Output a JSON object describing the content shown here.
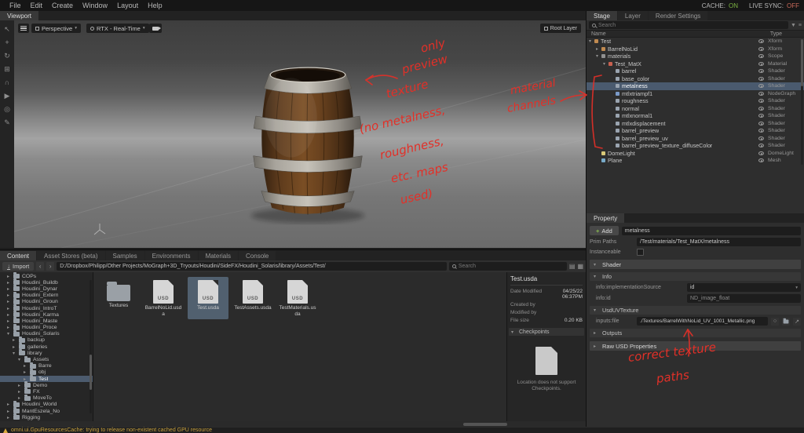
{
  "menu": {
    "items": [
      "File",
      "Edit",
      "Create",
      "Window",
      "Layout",
      "Help"
    ],
    "cache_label": "CACHE:",
    "cache_value": "ON",
    "live_sync_label": "LIVE SYNC:",
    "live_sync_value": "OFF"
  },
  "viewport": {
    "tab": "Viewport",
    "camera": "Perspective",
    "renderer": "RTX - Real-Time",
    "root_layer": "Root Layer",
    "tools": [
      {
        "name": "select-tool",
        "glyph": "↖"
      },
      {
        "name": "move-tool",
        "glyph": "+"
      },
      {
        "name": "rotate-tool",
        "glyph": "↻"
      },
      {
        "name": "scale-tool",
        "glyph": "⊞"
      },
      {
        "name": "snap-tool",
        "glyph": "∩"
      },
      {
        "name": "play-tool",
        "glyph": "▶"
      },
      {
        "name": "focus-tool",
        "glyph": "◎"
      },
      {
        "name": "paint-tool",
        "glyph": "✎"
      }
    ]
  },
  "stage": {
    "tabs": [
      "Stage",
      "Layer",
      "Render Settings"
    ],
    "search_placeholder": "Search",
    "name_col": "Name",
    "type_col": "Type",
    "rows": [
      {
        "name": "Test",
        "type": "Xform",
        "depth": 0,
        "exp": "open"
      },
      {
        "name": "BarrelNoLid",
        "type": "Xform",
        "depth": 1,
        "exp": "closed"
      },
      {
        "name": "materials",
        "type": "Scope",
        "depth": 1,
        "exp": "open"
      },
      {
        "name": "Test_MatX",
        "type": "Material",
        "depth": 2,
        "exp": "open"
      },
      {
        "name": "barrel",
        "type": "Shader",
        "depth": 3,
        "exp": "none"
      },
      {
        "name": "base_color",
        "type": "Shader",
        "depth": 3,
        "exp": "none"
      },
      {
        "name": "metalness",
        "type": "Shader",
        "depth": 3,
        "exp": "none",
        "selected": true
      },
      {
        "name": "mtlxtriampf1",
        "type": "NodeGraph",
        "depth": 3,
        "exp": "none"
      },
      {
        "name": "roughness",
        "type": "Shader",
        "depth": 3,
        "exp": "none"
      },
      {
        "name": "normal",
        "type": "Shader",
        "depth": 3,
        "exp": "none"
      },
      {
        "name": "mtlxnormal1",
        "type": "Shader",
        "depth": 3,
        "exp": "none"
      },
      {
        "name": "mtlxdisplacement",
        "type": "Shader",
        "depth": 3,
        "exp": "none"
      },
      {
        "name": "barrel_preview",
        "type": "Shader",
        "depth": 3,
        "exp": "none"
      },
      {
        "name": "barrel_preview_uv",
        "type": "Shader",
        "depth": 3,
        "exp": "none"
      },
      {
        "name": "barrel_preview_texture_diffuseColor",
        "type": "Shader",
        "depth": 3,
        "exp": "none"
      },
      {
        "name": "DomeLight",
        "type": "DomeLight",
        "depth": 1,
        "exp": "none"
      },
      {
        "name": "Plane",
        "type": "Mesh",
        "depth": 1,
        "exp": "none"
      }
    ]
  },
  "property": {
    "tab": "Property",
    "add_label": "Add",
    "name_value": "metalness",
    "prim_paths_label": "Prim Paths",
    "prim_paths_value": "/Test/materials/Test_MatX/metalness",
    "instanceable_label": "Instanceable",
    "shader_section": "Shader",
    "info_section": "Info",
    "impl_label": "info:implementationSource",
    "impl_value": "id",
    "id_label": "info:id",
    "id_value": "ND_image_float",
    "texture_section": "UsdUVTexture",
    "file_label": "inputs:file",
    "file_value": "./Textures/BarrelWithNoLid_UV_1001_Metallic.png",
    "outputs_section": "Outputs",
    "raw_section": "Raw USD Properties"
  },
  "content": {
    "tabs": [
      "Content",
      "Asset Stores (beta)",
      "Samples",
      "Environments",
      "Materials",
      "Console"
    ],
    "import_label": "Import",
    "path": "D:/Dropbox/Philipp/Other Projects/MoGraph+3D_Tryouts/Houdini/SideFX/Houdini_Solaris/library/Assets/Test/",
    "search_placeholder": "Search",
    "tree": [
      {
        "label": "COPs",
        "depth": 1,
        "exp": "closed"
      },
      {
        "label": "Houdini_Buildb",
        "depth": 1,
        "exp": "closed"
      },
      {
        "label": "Houdini_Dynar",
        "depth": 1,
        "exp": "closed"
      },
      {
        "label": "Houdini_Extern",
        "depth": 1,
        "exp": "closed"
      },
      {
        "label": "Houdini_Groun",
        "depth": 1,
        "exp": "closed"
      },
      {
        "label": "Houdini_IntroT",
        "depth": 1,
        "exp": "closed"
      },
      {
        "label": "Houdini_Karma",
        "depth": 1,
        "exp": "closed"
      },
      {
        "label": "Houdini_Maste",
        "depth": 1,
        "exp": "closed"
      },
      {
        "label": "Houdini_Proce",
        "depth": 1,
        "exp": "closed"
      },
      {
        "label": "Houdini_Solaris",
        "depth": 1,
        "exp": "open"
      },
      {
        "label": "backup",
        "depth": 2,
        "exp": "closed"
      },
      {
        "label": "galleries",
        "depth": 2,
        "exp": "closed"
      },
      {
        "label": "library",
        "depth": 2,
        "exp": "open"
      },
      {
        "label": "Assets",
        "depth": 3,
        "exp": "open"
      },
      {
        "label": "Barre",
        "depth": 4,
        "exp": "closed"
      },
      {
        "label": "obj",
        "depth": 4,
        "exp": "closed"
      },
      {
        "label": "Test",
        "depth": 4,
        "exp": "closed",
        "selected": true
      },
      {
        "label": "Demo",
        "depth": 3,
        "exp": "closed"
      },
      {
        "label": "FX",
        "depth": 3,
        "exp": "closed"
      },
      {
        "label": "MoveTo",
        "depth": 3,
        "exp": "closed"
      },
      {
        "label": "Houdini_World",
        "depth": 1,
        "exp": "closed"
      },
      {
        "label": "MantEszela_No",
        "depth": 1,
        "exp": "closed"
      },
      {
        "label": "Rigging",
        "depth": 1,
        "exp": "closed"
      }
    ],
    "files": [
      {
        "name": "Textures",
        "kind": "folder"
      },
      {
        "name": "BarrelNoLid.usda",
        "kind": "usd"
      },
      {
        "name": "Test.usda",
        "kind": "usd",
        "selected": true
      },
      {
        "name": "TestAssets.usda",
        "kind": "usd"
      },
      {
        "name": "TestMaterials.usda",
        "kind": "usd"
      }
    ],
    "details": {
      "title": "Test.usda",
      "date_label": "Date Modified",
      "date_value": "04/25/22 06:37PM",
      "created_label": "Created by",
      "created_value": "",
      "modified_label": "Modified by",
      "modified_value": "",
      "size_label": "File size",
      "size_value": "0.20 KB",
      "checkpoints_label": "Checkpoints",
      "checkpoints_message": "Location does not support Checkpoints."
    }
  },
  "status": {
    "warning": "omni.ui.GpuResourcesCache: trying to release non-existent cached GPU resource"
  },
  "annotations": {
    "note_only": "only",
    "note_preview": "preview",
    "note_texture": "texture",
    "note_no": "(no metalness,",
    "note_rough": "roughness,",
    "note_etc": "etc. maps",
    "note_used": "used)",
    "mat_line1": "material",
    "mat_line2": "channels",
    "tex_line1": "correct texture",
    "tex_line2": "paths"
  },
  "colors": {
    "annotation_red": "#e23028",
    "warning_orange": "#c9a23f",
    "selection_blue": "#4a5a6e"
  }
}
